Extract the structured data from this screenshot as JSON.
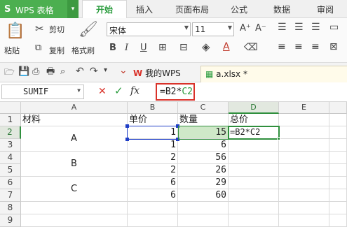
{
  "app": {
    "logo_s": "S",
    "title": "WPS 表格",
    "dropdown": "▾"
  },
  "menu": {
    "tabs": [
      "开始",
      "插入",
      "页面布局",
      "公式",
      "数据",
      "审阅"
    ]
  },
  "ribbon": {
    "paste": "粘贴",
    "cut": "剪切",
    "copy": "复制",
    "format_painter": "格式刷",
    "font_name": "宋体",
    "font_size": "11",
    "increase_font": "A⁺",
    "decrease_font": "A⁻",
    "bold": "B",
    "italic": "I",
    "underline": "U"
  },
  "quickbar": {
    "tabs": [
      {
        "label": "我的WPS"
      },
      {
        "label": "a.xlsx *"
      }
    ]
  },
  "formula_bar": {
    "name_box": "SUMIF",
    "cancel": "✕",
    "confirm": "✓",
    "fx": "fx",
    "formula_text": "=B2*",
    "formula_ref": "C2"
  },
  "sheet": {
    "columns": [
      "A",
      "B",
      "C",
      "D",
      "E"
    ],
    "rows": [
      "1",
      "2",
      "3",
      "4",
      "5",
      "6",
      "7",
      "8",
      "9"
    ],
    "headers": [
      "材料",
      "单价",
      "数量",
      "总价"
    ],
    "groups": [
      "A",
      "B",
      "C"
    ],
    "unit_price": [
      1,
      1,
      2,
      2,
      6,
      6
    ],
    "quantity": [
      15,
      6,
      56,
      26,
      29,
      60
    ],
    "editing_cell": "=B2*C2"
  },
  "colors": {
    "accent": "#4caf50",
    "selection_green": "#2f8f3d",
    "ref_blue": "#1f3ec7",
    "formula_border": "#d9322a"
  }
}
